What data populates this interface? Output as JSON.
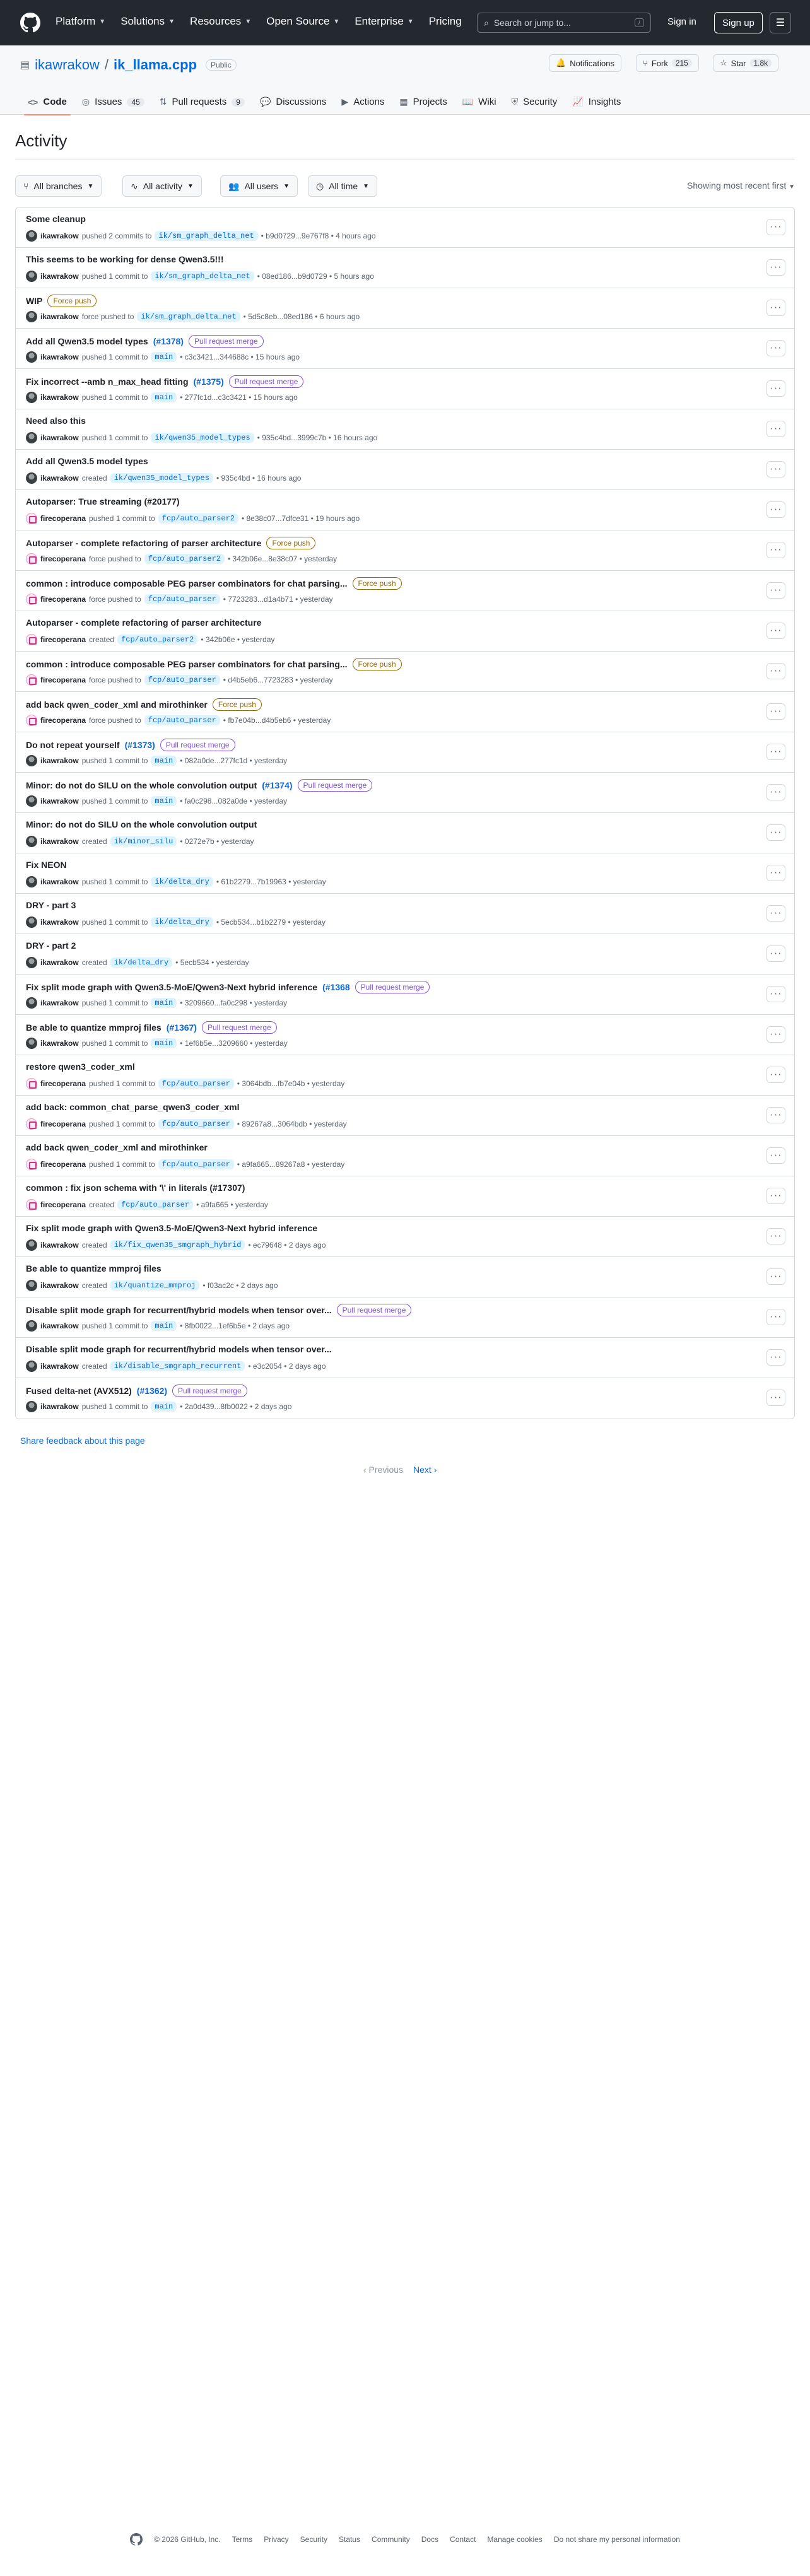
{
  "header": {
    "nav": [
      "Platform",
      "Solutions",
      "Resources",
      "Open Source",
      "Enterprise",
      "Pricing"
    ],
    "search_placeholder": "Search or jump to...",
    "search_key": "/",
    "signin": "Sign in",
    "signup": "Sign up"
  },
  "repo": {
    "owner": "ikawrakow",
    "sep": "/",
    "name": "ik_llama.cpp",
    "visibility": "Public",
    "notifications": "Notifications",
    "fork_label": "Fork",
    "fork_count": "215",
    "star_label": "Star",
    "star_count": "1.8k"
  },
  "tabs": [
    {
      "label": "Code"
    },
    {
      "label": "Issues",
      "count": "45"
    },
    {
      "label": "Pull requests",
      "count": "9"
    },
    {
      "label": "Discussions"
    },
    {
      "label": "Actions"
    },
    {
      "label": "Projects"
    },
    {
      "label": "Wiki"
    },
    {
      "label": "Security"
    },
    {
      "label": "Insights"
    }
  ],
  "activity": {
    "title": "Activity",
    "filters": [
      "All branches",
      "All activity",
      "All users",
      "All time"
    ],
    "sort": "Showing most recent first"
  },
  "events": [
    {
      "title": "Some cleanup",
      "user": "ikawrakow",
      "av": "ik",
      "pre": "pushed 2 commits to",
      "branch": "ik/sm_graph_delta_net",
      "post": "• b9d0729...9e767f8 • 4 hours ago"
    },
    {
      "title": "This seems to be working for dense Qwen3.5!!!",
      "user": "ikawrakow",
      "av": "ik",
      "pre": "pushed 1 commit to",
      "branch": "ik/sm_graph_delta_net",
      "post": "• 08ed186...b9d0729 • 5 hours ago"
    },
    {
      "title": "WIP",
      "badge": "Force push",
      "bt": "force",
      "user": "ikawrakow",
      "av": "ik",
      "pre": "force pushed to",
      "branch": "ik/sm_graph_delta_net",
      "post": "• 5d5c8eb...08ed186 • 6 hours ago"
    },
    {
      "title": "Add all Qwen3.5 model types",
      "pr": "(#1378)",
      "badge": "Pull request merge",
      "bt": "merge",
      "user": "ikawrakow",
      "av": "ik",
      "pre": "pushed 1 commit to",
      "branch": "main",
      "post": "• c3c3421...344688c • 15 hours ago"
    },
    {
      "title": "Fix incorrect --amb n_max_head fitting",
      "pr": "(#1375)",
      "badge": "Pull request merge",
      "bt": "merge",
      "user": "ikawrakow",
      "av": "ik",
      "pre": "pushed 1 commit to",
      "branch": "main",
      "post": "• 277fc1d...c3c3421 • 15 hours ago"
    },
    {
      "title": "Need also this",
      "user": "ikawrakow",
      "av": "ik",
      "pre": "pushed 1 commit to",
      "branch": "ik/qwen35_model_types",
      "post": "• 935c4bd...3999c7b • 16 hours ago"
    },
    {
      "title": "Add all Qwen3.5 model types",
      "user": "ikawrakow",
      "av": "ik",
      "pre": "created",
      "branch": "ik/qwen35_model_types",
      "post": "• 935c4bd • 16 hours ago"
    },
    {
      "title": "Autoparser: True streaming (#20177)",
      "user": "firecoperana",
      "av": "fc",
      "pre": "pushed 1 commit to",
      "branch": "fcp/auto_parser2",
      "post": "• 8e38c07...7dfce31 • 19 hours ago"
    },
    {
      "title": "Autoparser - complete refactoring of parser architecture",
      "badge": "Force push",
      "bt": "force",
      "user": "firecoperana",
      "av": "fc",
      "pre": "force pushed to",
      "branch": "fcp/auto_parser2",
      "post": "• 342b06e...8e38c07 • yesterday"
    },
    {
      "title": "common : introduce composable PEG parser combinators for chat parsing...",
      "badge": "Force push",
      "bt": "force",
      "user": "firecoperana",
      "av": "fc",
      "pre": "force pushed to",
      "branch": "fcp/auto_parser",
      "post": "• 7723283...d1a4b71 • yesterday"
    },
    {
      "title": "Autoparser - complete refactoring of parser architecture",
      "user": "firecoperana",
      "av": "fc",
      "pre": "created",
      "branch": "fcp/auto_parser2",
      "post": "• 342b06e • yesterday"
    },
    {
      "title": "common : introduce composable PEG parser combinators for chat parsing...",
      "badge": "Force push",
      "bt": "force",
      "user": "firecoperana",
      "av": "fc",
      "pre": "force pushed to",
      "branch": "fcp/auto_parser",
      "post": "• d4b5eb6...7723283 • yesterday"
    },
    {
      "title": "add back qwen_coder_xml and mirothinker",
      "badge": "Force push",
      "bt": "force",
      "user": "firecoperana",
      "av": "fc",
      "pre": "force pushed to",
      "branch": "fcp/auto_parser",
      "post": "• fb7e04b...d4b5eb6 • yesterday"
    },
    {
      "title": "Do not repeat yourself",
      "pr": "(#1373)",
      "badge": "Pull request merge",
      "bt": "merge",
      "user": "ikawrakow",
      "av": "ik",
      "pre": "pushed 1 commit to",
      "branch": "main",
      "post": "• 082a0de...277fc1d • yesterday"
    },
    {
      "title": "Minor: do not do SILU on the whole convolution output",
      "pr": "(#1374)",
      "badge": "Pull request merge",
      "bt": "merge",
      "user": "ikawrakow",
      "av": "ik",
      "pre": "pushed 1 commit to",
      "branch": "main",
      "post": "• fa0c298...082a0de • yesterday"
    },
    {
      "title": "Minor: do not do SILU on the whole convolution output",
      "user": "ikawrakow",
      "av": "ik",
      "pre": "created",
      "branch": "ik/minor_silu",
      "post": "• 0272e7b • yesterday"
    },
    {
      "title": "Fix NEON",
      "user": "ikawrakow",
      "av": "ik",
      "pre": "pushed 1 commit to",
      "branch": "ik/delta_dry",
      "post": "• 61b2279...7b19963 • yesterday"
    },
    {
      "title": "DRY - part 3",
      "user": "ikawrakow",
      "av": "ik",
      "pre": "pushed 1 commit to",
      "branch": "ik/delta_dry",
      "post": "• 5ecb534...b1b2279 • yesterday"
    },
    {
      "title": "DRY - part 2",
      "user": "ikawrakow",
      "av": "ik",
      "pre": "created",
      "branch": "ik/delta_dry",
      "post": "• 5ecb534 • yesterday"
    },
    {
      "title": "Fix split mode graph with Qwen3.5-MoE/Qwen3-Next hybrid inference",
      "pr": "(#1368",
      "badge": "Pull request merge",
      "bt": "merge",
      "user": "ikawrakow",
      "av": "ik",
      "pre": "pushed 1 commit to",
      "branch": "main",
      "post": "• 3209660...fa0c298 • yesterday"
    },
    {
      "title": "Be able to quantize mmproj files",
      "pr": "(#1367)",
      "badge": "Pull request merge",
      "bt": "merge",
      "user": "ikawrakow",
      "av": "ik",
      "pre": "pushed 1 commit to",
      "branch": "main",
      "post": "• 1ef6b5e...3209660 • yesterday"
    },
    {
      "title": "restore qwen3_coder_xml",
      "user": "firecoperana",
      "av": "fc",
      "pre": "pushed 1 commit to",
      "branch": "fcp/auto_parser",
      "post": "• 3064bdb...fb7e04b • yesterday"
    },
    {
      "title": "add back: common_chat_parse_qwen3_coder_xml",
      "user": "firecoperana",
      "av": "fc",
      "pre": "pushed 1 commit to",
      "branch": "fcp/auto_parser",
      "post": "• 89267a8...3064bdb • yesterday"
    },
    {
      "title": "add back qwen_coder_xml and mirothinker",
      "user": "firecoperana",
      "av": "fc",
      "pre": "pushed 1 commit to",
      "branch": "fcp/auto_parser",
      "post": "• a9fa665...89267a8 • yesterday"
    },
    {
      "title": "common : fix json schema with '\\' in literals (#17307)",
      "user": "firecoperana",
      "av": "fc",
      "pre": "created",
      "branch": "fcp/auto_parser",
      "post": "• a9fa665 • yesterday"
    },
    {
      "title": "Fix split mode graph with Qwen3.5-MoE/Qwen3-Next hybrid inference",
      "user": "ikawrakow",
      "av": "ik",
      "pre": "created",
      "branch": "ik/fix_qwen35_smgraph_hybrid",
      "post": "• ec79648 • 2 days ago"
    },
    {
      "title": "Be able to quantize mmproj files",
      "user": "ikawrakow",
      "av": "ik",
      "pre": "created",
      "branch": "ik/quantize_mmproj",
      "post": "• f03ac2c • 2 days ago"
    },
    {
      "title": "Disable split mode graph for recurrent/hybrid models when tensor over...",
      "badge": "Pull request merge",
      "bt": "merge",
      "user": "ikawrakow",
      "av": "ik",
      "pre": "pushed 1 commit to",
      "branch": "main",
      "post": "• 8fb0022...1ef6b5e • 2 days ago"
    },
    {
      "title": "Disable split mode graph for recurrent/hybrid models when tensor over...",
      "user": "ikawrakow",
      "av": "ik",
      "pre": "created",
      "branch": "ik/disable_smgraph_recurrent",
      "post": "• e3c2054 • 2 days ago"
    },
    {
      "title": "Fused delta-net (AVX512)",
      "pr": "(#1362)",
      "badge": "Pull request merge",
      "bt": "merge",
      "user": "ikawrakow",
      "av": "ik",
      "pre": "pushed 1 commit to",
      "branch": "main",
      "post": "• 2a0d439...8fb0022 • 2 days ago"
    }
  ],
  "feedback": "Share feedback about this page",
  "pager": {
    "prev": "‹ Previous",
    "next": "Next ›"
  },
  "footer": [
    "© 2026 GitHub, Inc.",
    "Terms",
    "Privacy",
    "Security",
    "Status",
    "Community",
    "Docs",
    "Contact",
    "Manage cookies",
    "Do not share my personal information"
  ]
}
